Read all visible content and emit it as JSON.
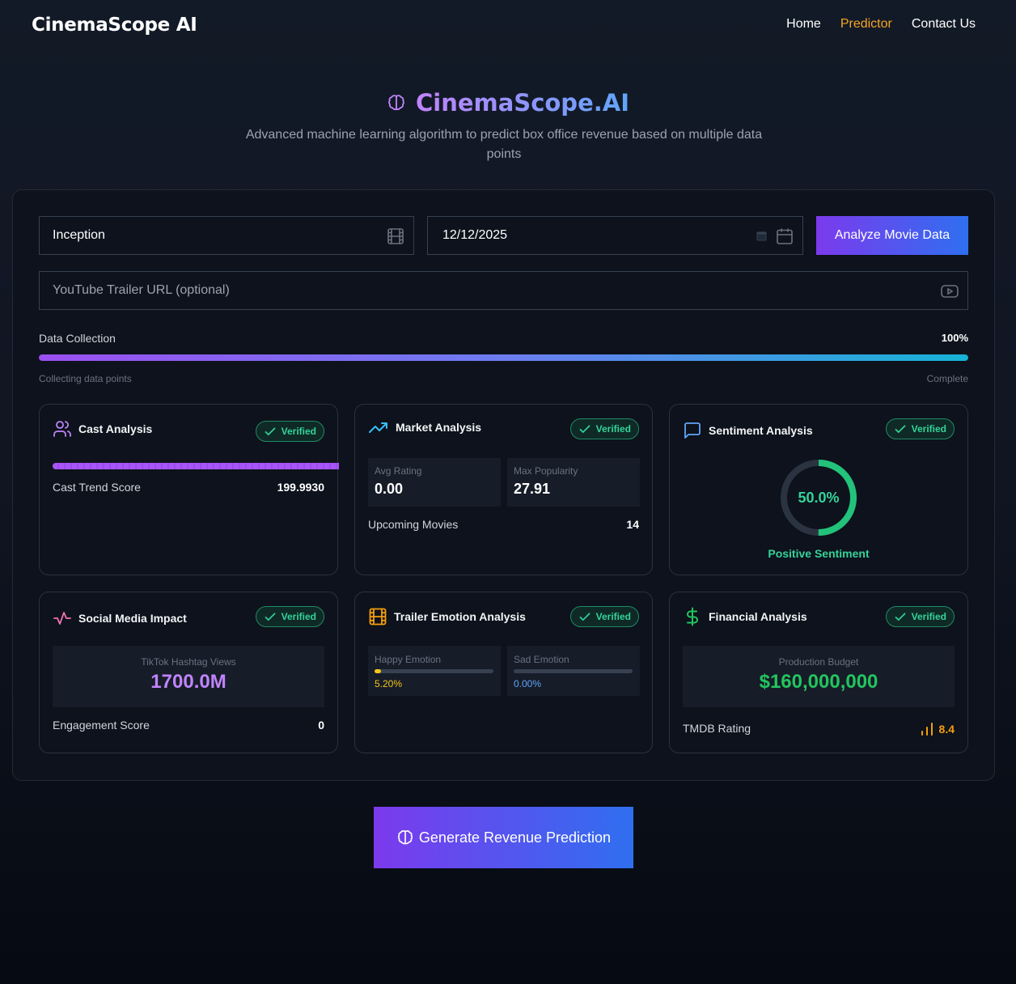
{
  "nav": {
    "brand": "CinemaScope AI",
    "links": [
      "Home",
      "Predictor",
      "Contact Us"
    ],
    "active": "Predictor"
  },
  "hero": {
    "title": "CinemaScope.AI",
    "subtitle": "Advanced machine learning algorithm to predict box office revenue based on multiple data points"
  },
  "form": {
    "movie_title": "Inception",
    "release_date": "12/12/2025",
    "analyze_label": "Analyze Movie Data",
    "trailer_placeholder": "YouTube Trailer URL (optional)"
  },
  "progress": {
    "label": "Data Collection",
    "percent": "100%",
    "fraction": 1.0,
    "status_left": "Collecting data points",
    "status_right": "Complete"
  },
  "cards": {
    "cast": {
      "title": "Cast Analysis",
      "badge": "Verified",
      "metric_label": "Cast Trend Score",
      "metric_value": "199.9930"
    },
    "market": {
      "title": "Market Analysis",
      "badge": "Verified",
      "avg_rating_label": "Avg Rating",
      "avg_rating": "0.00",
      "max_pop_label": "Max Popularity",
      "max_pop": "27.91",
      "upcoming_label": "Upcoming Movies",
      "upcoming": "14"
    },
    "sentiment": {
      "title": "Sentiment Analysis",
      "badge": "Verified",
      "percent_text": "50.0%",
      "fraction": 0.5,
      "caption": "Positive Sentiment"
    },
    "social": {
      "title": "Social Media Impact",
      "badge": "Verified",
      "views_label": "TikTok Hashtag Views",
      "views": "1700.0M",
      "engagement_label": "Engagement Score",
      "engagement": "0"
    },
    "trailer": {
      "title": "Trailer Emotion Analysis",
      "badge": "Verified",
      "happy_label": "Happy Emotion",
      "happy_text": "5.20%",
      "happy_fraction": 0.052,
      "sad_label": "Sad Emotion",
      "sad_text": "0.00%",
      "sad_fraction": 0.0
    },
    "financial": {
      "title": "Financial Analysis",
      "badge": "Verified",
      "budget_label": "Production Budget",
      "budget": "$160,000,000",
      "rating_label": "TMDB Rating",
      "rating": "8.4"
    }
  },
  "generate_label": "Generate Revenue Prediction",
  "colors": {
    "accent_purple": "#7c3aed",
    "accent_blue": "#2f6ff0",
    "active_nav": "#f5a524",
    "verified_green": "#34d399",
    "budget_green": "#22c55e",
    "views_purple": "#c084fc"
  },
  "icons": [
    "brain-icon",
    "film-icon",
    "calendar-icon",
    "youtube-icon",
    "users-icon",
    "trending-up-icon",
    "message-square-icon",
    "activity-icon",
    "film-strip-icon",
    "dollar-sign-icon",
    "check-icon",
    "bar-chart-icon"
  ]
}
